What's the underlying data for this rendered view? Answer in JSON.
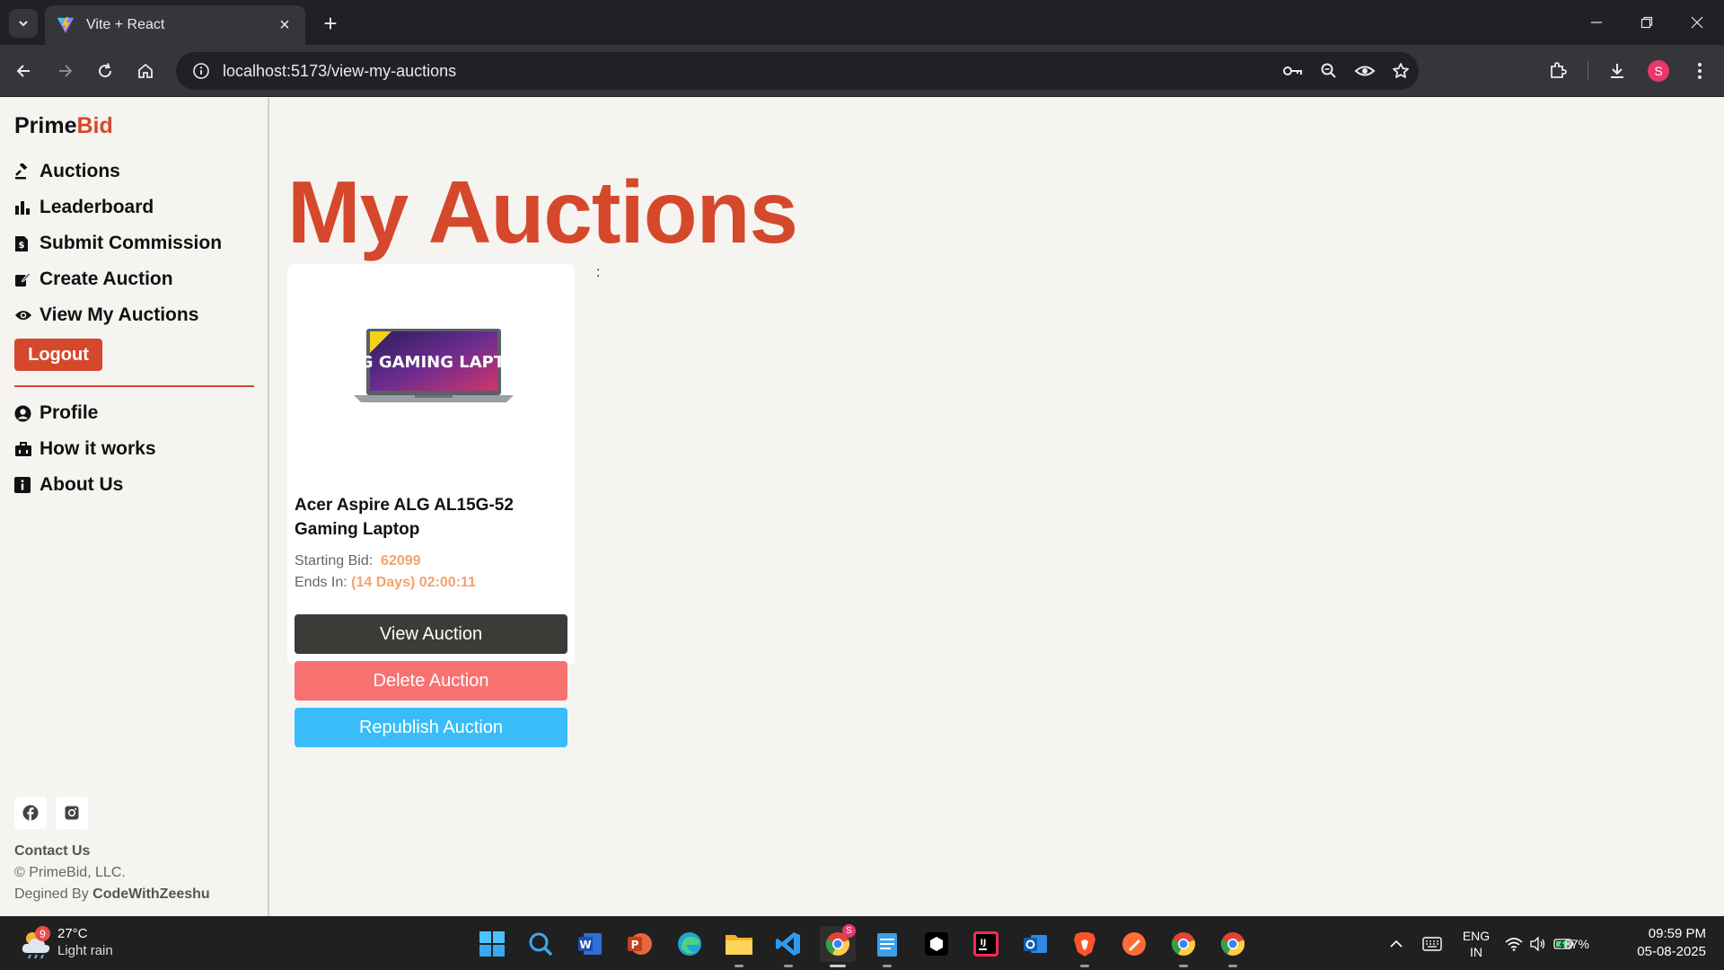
{
  "browser": {
    "tab_title": "Vite + React",
    "url": "localhost:5173/view-my-auctions",
    "profile_initial": "S"
  },
  "sidebar": {
    "brand_main": "Prime",
    "brand_accent": "Bid",
    "nav": [
      {
        "label": "Auctions",
        "icon": "gavel-icon"
      },
      {
        "label": "Leaderboard",
        "icon": "bar-chart-icon"
      },
      {
        "label": "Submit Commission",
        "icon": "receipt-icon"
      },
      {
        "label": "Create Auction",
        "icon": "edit-icon"
      },
      {
        "label": "View My Auctions",
        "icon": "eye-icon"
      }
    ],
    "logout_label": "Logout",
    "nav2": [
      {
        "label": "Profile",
        "icon": "user-circle-icon"
      },
      {
        "label": "How it works",
        "icon": "briefcase-icon"
      },
      {
        "label": "About Us",
        "icon": "info-icon"
      }
    ],
    "contact_label": "Contact Us",
    "copyright": "© PrimeBid, LLC.",
    "designed_prefix": "Degined By ",
    "designed_by": "CodeWithZeeshu"
  },
  "main": {
    "title": "My Auctions",
    "stray_text": ":",
    "card": {
      "image_text": "ALG GAMING LAPTOP",
      "name": "Acer Aspire ALG AL15G-52 Gaming Laptop",
      "starting_bid_label": "Starting Bid:",
      "starting_bid_value": "62099",
      "ends_in_label": "Ends In:",
      "ends_in_value": "(14 Days) 02:00:11",
      "view_label": "View Auction",
      "delete_label": "Delete Auction",
      "republish_label": "Republish Auction"
    }
  },
  "taskbar": {
    "weather_temp": "27°C",
    "weather_desc": "Light rain",
    "weather_badge": "9",
    "lang_line1": "ENG",
    "lang_line2": "IN",
    "battery": "87%",
    "time": "09:59 PM",
    "date": "05-08-2025"
  },
  "colors": {
    "accent": "#d6482b",
    "view_button": "#3d3b38",
    "delete_button": "#f87171",
    "republish_button": "#38bdf8",
    "value_text": "#f4a26e"
  }
}
